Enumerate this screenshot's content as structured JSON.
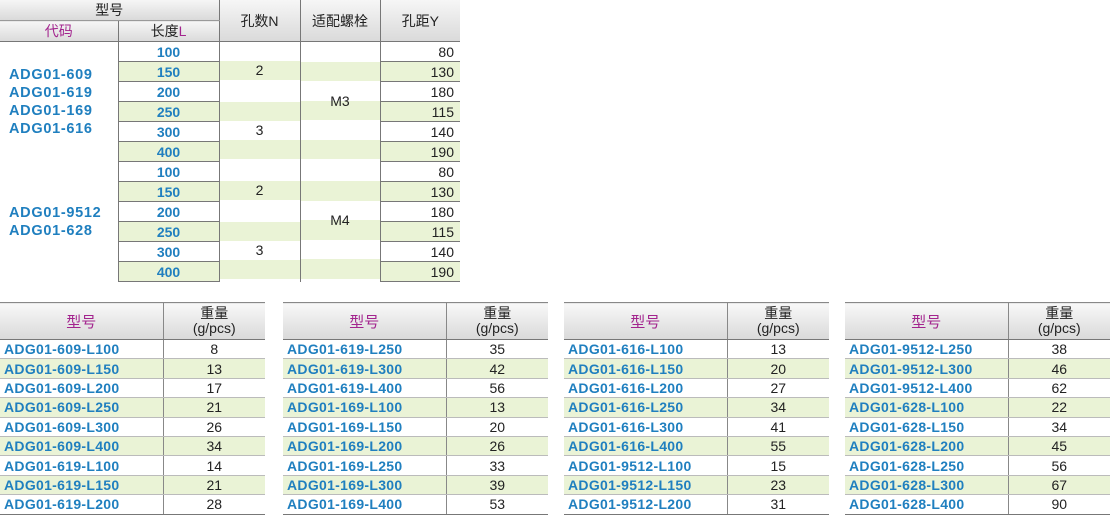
{
  "spec_table": {
    "header": {
      "model": "型号",
      "code": "代码",
      "length": "长度",
      "length_suffix": "L",
      "holes": "孔数N",
      "bolt": "适配螺栓",
      "pitch": "孔距Y"
    },
    "groups": [
      {
        "codes": [
          "ADG01-609",
          "ADG01-619",
          "ADG01-169",
          "ADG01-616"
        ],
        "bolt": "M3",
        "rows": [
          {
            "length": "100",
            "holes": "",
            "pitch": "80"
          },
          {
            "length": "150",
            "holes": "2",
            "pitch": "130"
          },
          {
            "length": "200",
            "holes": "",
            "pitch": "180"
          },
          {
            "length": "250",
            "holes": "",
            "pitch": "115"
          },
          {
            "length": "300",
            "holes": "3",
            "pitch": "140"
          },
          {
            "length": "400",
            "holes": "",
            "pitch": "190"
          }
        ]
      },
      {
        "codes": [
          "ADG01-9512",
          "ADG01-628"
        ],
        "bolt": "M4",
        "rows": [
          {
            "length": "100",
            "holes": "",
            "pitch": "80"
          },
          {
            "length": "150",
            "holes": "2",
            "pitch": "130"
          },
          {
            "length": "200",
            "holes": "",
            "pitch": "180"
          },
          {
            "length": "250",
            "holes": "",
            "pitch": "115"
          },
          {
            "length": "300",
            "holes": "3",
            "pitch": "140"
          },
          {
            "length": "400",
            "holes": "",
            "pitch": "190"
          }
        ]
      }
    ]
  },
  "weight_header": {
    "model": "型号",
    "weight_line1": "重量",
    "weight_line2": "(g/pcs)"
  },
  "weight_tables": [
    {
      "rows": [
        {
          "model": "ADG01-609-L100",
          "weight": "8"
        },
        {
          "model": "ADG01-609-L150",
          "weight": "13"
        },
        {
          "model": "ADG01-609-L200",
          "weight": "17"
        },
        {
          "model": "ADG01-609-L250",
          "weight": "21"
        },
        {
          "model": "ADG01-609-L300",
          "weight": "26"
        },
        {
          "model": "ADG01-609-L400",
          "weight": "34"
        },
        {
          "model": "ADG01-619-L100",
          "weight": "14"
        },
        {
          "model": "ADG01-619-L150",
          "weight": "21"
        },
        {
          "model": "ADG01-619-L200",
          "weight": "28"
        }
      ]
    },
    {
      "rows": [
        {
          "model": "ADG01-619-L250",
          "weight": "35"
        },
        {
          "model": "ADG01-619-L300",
          "weight": "42"
        },
        {
          "model": "ADG01-619-L400",
          "weight": "56"
        },
        {
          "model": "ADG01-169-L100",
          "weight": "13"
        },
        {
          "model": "ADG01-169-L150",
          "weight": "20"
        },
        {
          "model": "ADG01-169-L200",
          "weight": "26"
        },
        {
          "model": "ADG01-169-L250",
          "weight": "33"
        },
        {
          "model": "ADG01-169-L300",
          "weight": "39"
        },
        {
          "model": "ADG01-169-L400",
          "weight": "53"
        }
      ]
    },
    {
      "rows": [
        {
          "model": "ADG01-616-L100",
          "weight": "13"
        },
        {
          "model": "ADG01-616-L150",
          "weight": "20"
        },
        {
          "model": "ADG01-616-L200",
          "weight": "27"
        },
        {
          "model": "ADG01-616-L250",
          "weight": "34"
        },
        {
          "model": "ADG01-616-L300",
          "weight": "41"
        },
        {
          "model": "ADG01-616-L400",
          "weight": "55"
        },
        {
          "model": "ADG01-9512-L100",
          "weight": "15"
        },
        {
          "model": "ADG01-9512-L150",
          "weight": "23"
        },
        {
          "model": "ADG01-9512-L200",
          "weight": "31"
        }
      ]
    },
    {
      "rows": [
        {
          "model": "ADG01-9512-L250",
          "weight": "38"
        },
        {
          "model": "ADG01-9512-L300",
          "weight": "46"
        },
        {
          "model": "ADG01-9512-L400",
          "weight": "62"
        },
        {
          "model": "ADG01-628-L100",
          "weight": "22"
        },
        {
          "model": "ADG01-628-L150",
          "weight": "34"
        },
        {
          "model": "ADG01-628-L200",
          "weight": "45"
        },
        {
          "model": "ADG01-628-L250",
          "weight": "56"
        },
        {
          "model": "ADG01-628-L300",
          "weight": "67"
        },
        {
          "model": "ADG01-628-L400",
          "weight": "90"
        }
      ]
    }
  ],
  "colors": {
    "code_blue": "#1f7fbf",
    "header_magenta": "#a3248e",
    "stripe_green": "#eaf3d6"
  }
}
